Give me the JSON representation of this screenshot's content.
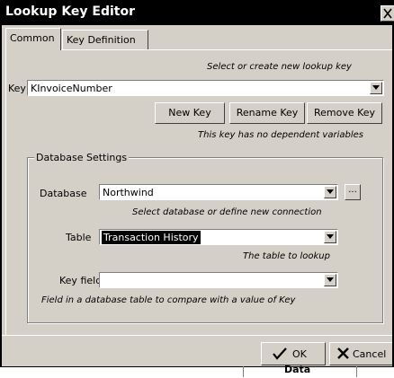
{
  "window": {
    "title": "Lookup Key Editor"
  },
  "tabs": [
    {
      "label": "Common",
      "active": true
    },
    {
      "label": "Key Definition",
      "active": false
    }
  ],
  "key": {
    "hint": "Select or create new lookup key",
    "label": "Key",
    "value": "KInvoiceNumber"
  },
  "key_buttons": {
    "new": "New Key",
    "rename": "Rename Key",
    "remove": "Remove Key"
  },
  "key_status": "This key has no dependent variables",
  "database_settings": {
    "title": "Database Settings",
    "database_label": "Database",
    "database_value": "Northwind",
    "browse_label": "...",
    "database_hint": "Select database or define new connection",
    "table_label": "Table",
    "table_value": "Transaction History",
    "table_hint": "The table to lookup",
    "keyfield_label": "Key field",
    "keyfield_value": "",
    "keyfield_hint": "Field in a database table to compare with a value of Key"
  },
  "footer": {
    "ok": "OK",
    "cancel": "Cancel"
  },
  "background": {
    "partial_label": "Data"
  }
}
